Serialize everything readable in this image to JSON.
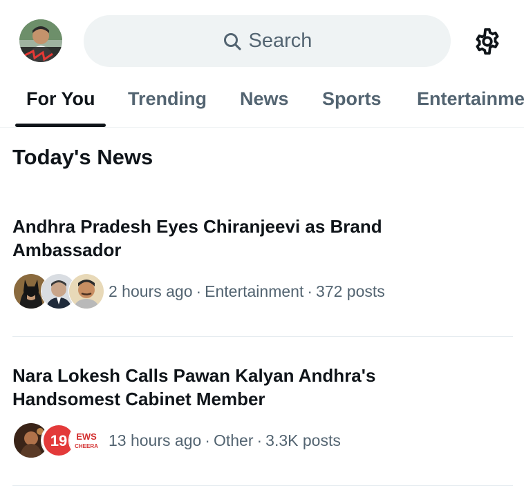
{
  "header": {
    "avatar_icon": "profile-avatar",
    "search_placeholder": "Search",
    "settings_icon": "gear-icon"
  },
  "tabs": [
    {
      "label": "For You",
      "active": true
    },
    {
      "label": "Trending",
      "active": false
    },
    {
      "label": "News",
      "active": false
    },
    {
      "label": "Sports",
      "active": false
    },
    {
      "label": "Entertainment",
      "active": false
    }
  ],
  "section": {
    "title": "Today's News"
  },
  "stories": [
    {
      "headline": "Andhra Pradesh Eyes Chiranjeevi as Brand Ambassador",
      "time": "2 hours ago",
      "category": "Entertainment",
      "posts": "372 posts",
      "separator": "·"
    },
    {
      "headline": "Nara Lokesh Calls Pawan Kalyan Andhra's Handsomest Cabinet Member",
      "time": "13 hours ago",
      "category": "Other",
      "posts": "3.3K posts",
      "separator": "·",
      "badge_text": "19",
      "badge_text_2": "EWS",
      "badge_text_3": "CHEERA"
    }
  ],
  "colors": {
    "text_primary": "#0f1419",
    "text_secondary": "#536471",
    "search_bg": "#eff3f4",
    "divider": "#e6ecf0"
  }
}
